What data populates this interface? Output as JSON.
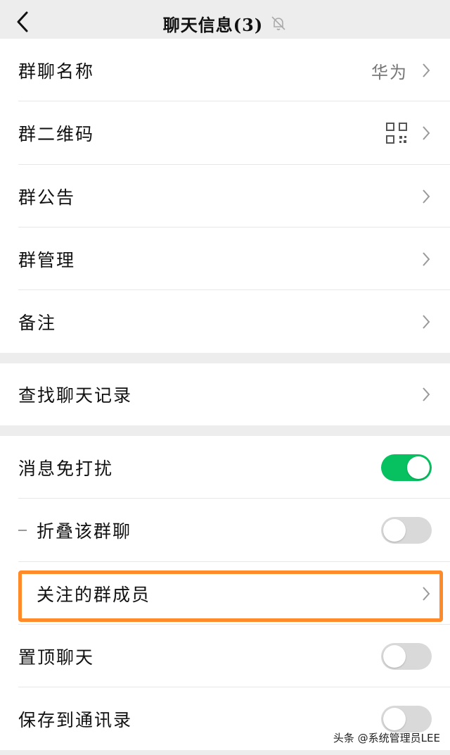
{
  "header": {
    "title": "聊天信息(3)",
    "mute_icon": "bell-slash-icon",
    "back_icon": "chevron-left-icon"
  },
  "section1": {
    "group_name_label": "群聊名称",
    "group_name_value": "华为",
    "group_qr_label": "群二维码",
    "group_notice_label": "群公告",
    "group_manage_label": "群管理",
    "remark_label": "备注"
  },
  "section2": {
    "search_history_label": "查找聊天记录"
  },
  "section3": {
    "dnd_label": "消息免打扰",
    "dnd_on": true,
    "fold_label": "折叠该群聊",
    "fold_on": false,
    "followed_members_label": "关注的群成员",
    "pin_label": "置顶聊天",
    "pin_on": false,
    "save_contacts_label": "保存到通讯录",
    "save_on": false
  },
  "colors": {
    "toggle_on": "#07c160",
    "highlight": "#ff8a2a"
  },
  "watermark": "头条 @系统管理员LEE"
}
